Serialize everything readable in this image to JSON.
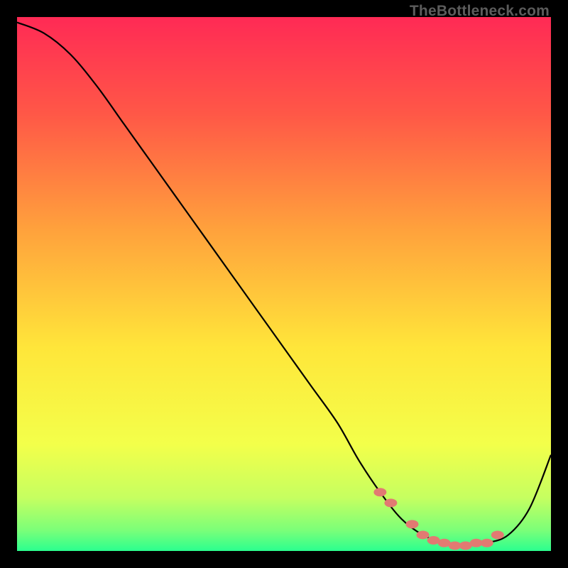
{
  "watermark": "TheBottleneck.com",
  "chart_data": {
    "type": "line",
    "title": "",
    "xlabel": "",
    "ylabel": "",
    "xlim": [
      0,
      100
    ],
    "ylim": [
      0,
      100
    ],
    "series": [
      {
        "name": "bottleneck-curve",
        "x": [
          0,
          5,
          10,
          15,
          20,
          25,
          30,
          35,
          40,
          45,
          50,
          55,
          60,
          64,
          68,
          72,
          76,
          80,
          84,
          88,
          92,
          96,
          100
        ],
        "values": [
          99,
          97,
          93,
          87,
          80,
          73,
          66,
          59,
          52,
          45,
          38,
          31,
          24,
          17,
          11,
          6,
          3,
          1.5,
          1,
          1.5,
          3,
          8,
          18
        ]
      }
    ],
    "markers": {
      "name": "highlight-dots",
      "color": "#e27a72",
      "x": [
        68,
        70,
        74,
        76,
        78,
        80,
        82,
        84,
        86,
        88,
        90
      ],
      "values": [
        11,
        9,
        5,
        3,
        2,
        1.5,
        1,
        1,
        1.5,
        1.5,
        3
      ]
    },
    "gradient_stops": [
      {
        "offset": 0.0,
        "color": "#ff2a55"
      },
      {
        "offset": 0.18,
        "color": "#ff5747"
      },
      {
        "offset": 0.4,
        "color": "#ffa23c"
      },
      {
        "offset": 0.62,
        "color": "#ffe63a"
      },
      {
        "offset": 0.8,
        "color": "#f3ff4a"
      },
      {
        "offset": 0.9,
        "color": "#c6ff60"
      },
      {
        "offset": 0.96,
        "color": "#7dff78"
      },
      {
        "offset": 1.0,
        "color": "#2bff8f"
      }
    ]
  }
}
